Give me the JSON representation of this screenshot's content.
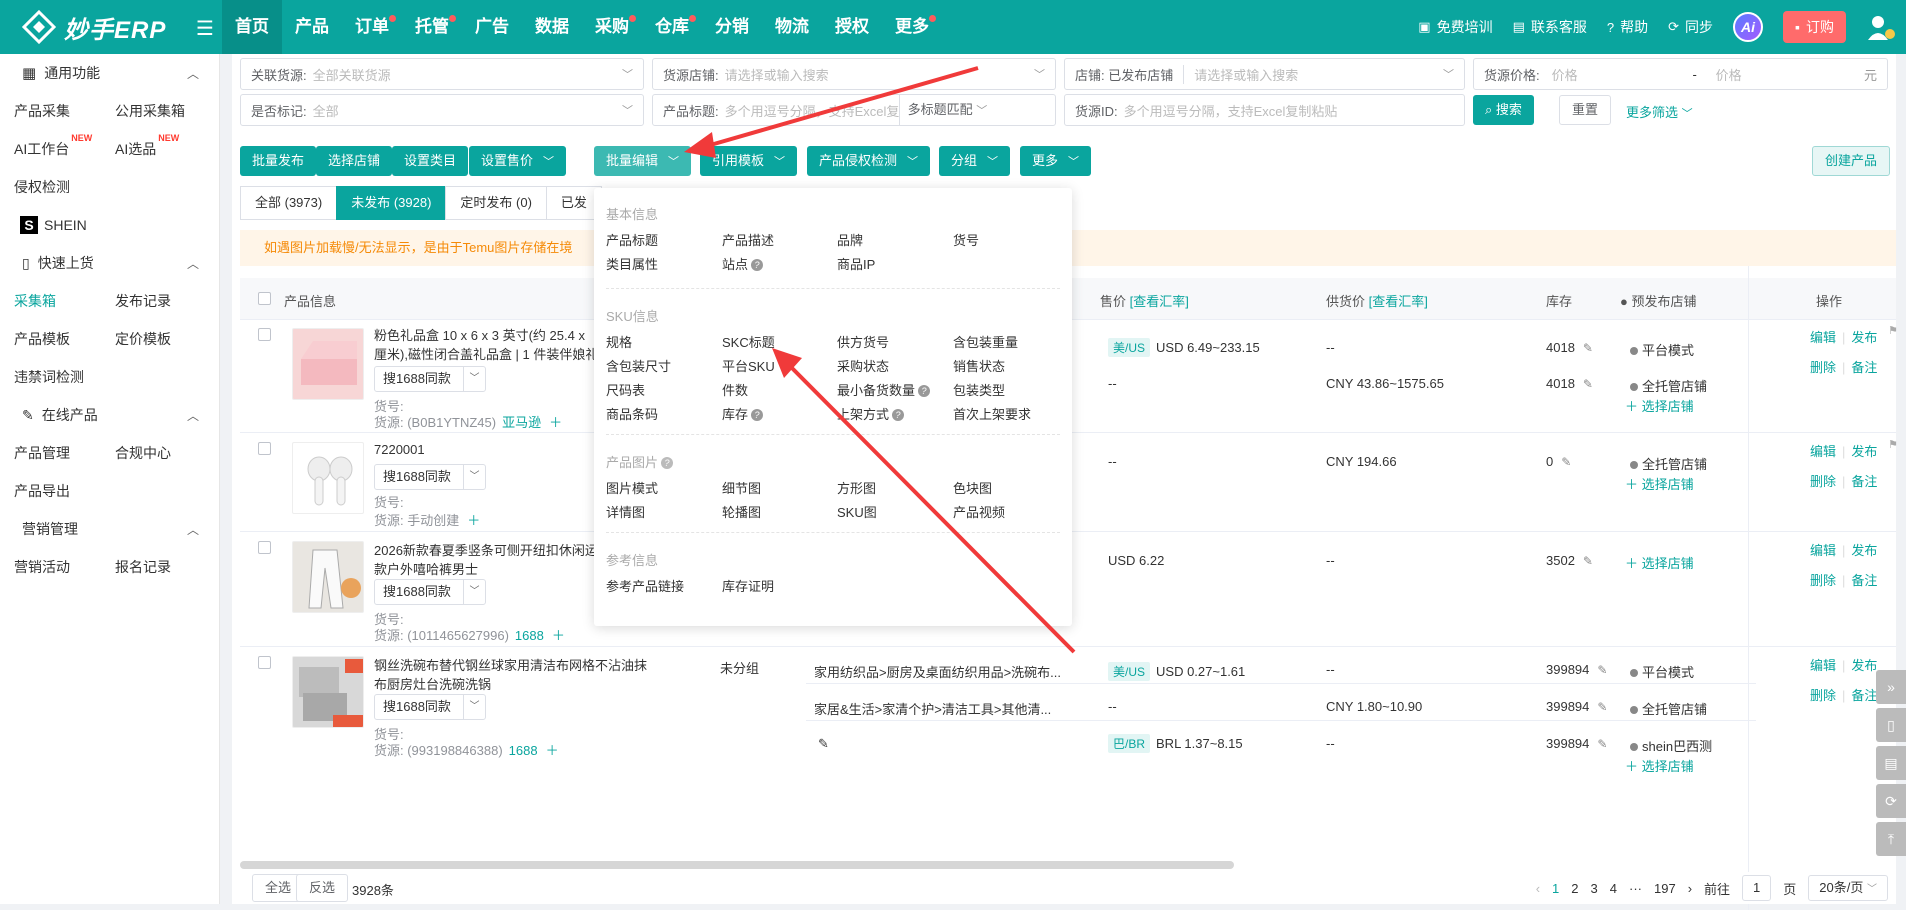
{
  "app": {
    "brand": "妙手ERP"
  },
  "nav": [
    {
      "label": "首页",
      "active": true,
      "dot": false
    },
    {
      "label": "产品",
      "dot": false
    },
    {
      "label": "订单",
      "dot": true
    },
    {
      "label": "托管",
      "dot": true
    },
    {
      "label": "广告",
      "dot": false
    },
    {
      "label": "数据",
      "dot": false
    },
    {
      "label": "采购",
      "dot": true
    },
    {
      "label": "仓库",
      "dot": true
    },
    {
      "label": "分销",
      "dot": false
    },
    {
      "label": "物流",
      "dot": false
    },
    {
      "label": "授权",
      "dot": false
    },
    {
      "label": "更多",
      "dot": true
    }
  ],
  "topright": {
    "training": "免费培训",
    "service": "联系客服",
    "help": "帮助",
    "sync": "同步",
    "ai": "Ai",
    "order": "订购"
  },
  "sidebar": {
    "general": "通用功能",
    "r1": [
      "产品采集",
      "公用采集箱"
    ],
    "r2": [
      "AI工作台",
      "AI选品"
    ],
    "new_tag": "NEW",
    "r3": "侵权检测",
    "shein_logo": "S",
    "shein": "SHEIN",
    "quick": "快速上货",
    "r4": [
      "采集箱",
      "发布记录"
    ],
    "r5": [
      "产品模板",
      "定价模板"
    ],
    "r6": "违禁词检测",
    "online": "在线产品",
    "r7": [
      "产品管理",
      "合规中心"
    ],
    "r8": "产品导出",
    "marketing": "营销管理",
    "r9": [
      "营销活动",
      "报名记录"
    ]
  },
  "filters": {
    "source_label": "关联货源:",
    "source_value": "全部关联货源",
    "store_label": "货源店铺:",
    "store_ph": "请选择或输入搜索",
    "shop_label": "店铺: 已发布店铺",
    "shop_ph": "请选择或输入搜索",
    "price_label": "货源价格:",
    "price_min_ph": "价格",
    "price_sep": "-",
    "price_max_ph": "价格",
    "price_unit": "元",
    "mark_label": "是否标记:",
    "mark_value": "全部",
    "title_label": "产品标题:",
    "title_ph": "多个用逗号分隔，支持Excel复制粘",
    "title_match": "多标题匹配",
    "srcid_label": "货源ID:",
    "srcid_ph": "多个用逗号分隔，支持Excel复制粘贴",
    "search_btn": "搜索",
    "reset_btn": "重置",
    "more_filter": "更多筛选"
  },
  "toolbar": {
    "batch_publish": "批量发布",
    "select_store": "选择店铺",
    "set_category": "设置类目",
    "set_price": "设置售价",
    "batch_edit": "批量编辑",
    "use_template": "引用模板",
    "infringement": "产品侵权检测",
    "group": "分组",
    "more": "更多",
    "create": "创建产品"
  },
  "tabs": [
    "全部 (3973)",
    "未发布 (3928)",
    "定时发布 (0)",
    "已发"
  ],
  "notice": "如遇图片加载慢/无法显示，是由于Temu图片存储在境",
  "table_head": {
    "product": "产品信息",
    "price": "售价",
    "price_link": "[查看汇率]",
    "supply": "供货价",
    "supply_link": "[查看汇率]",
    "stock": "库存",
    "prepub": "预发布店铺",
    "ops": "操作"
  },
  "rows": [
    {
      "title": "粉色礼品盒 10 x 6 x 3 英寸(约 25.4 x\n厘米),磁性闭合盖礼品盒 | 1 件装伴娘礼",
      "sel": "搜1688同款",
      "huohao": "货号:",
      "source": "货源: (B0B1YTNZ45)",
      "source_link": "亚马逊",
      "lines": [
        {
          "tag": "美/US",
          "price": "USD 6.49~233.15",
          "supply": "--",
          "stock": "4018",
          "store": "平台模式"
        },
        {
          "tag": "",
          "price": "--",
          "supply": "CNY 43.86~1575.65",
          "stock": "4018",
          "store": "全托管店铺"
        }
      ],
      "choose": "选择店铺"
    },
    {
      "title": "7220001",
      "sel": "搜1688同款",
      "huohao": "货号:",
      "source": "货源: 手动创建",
      "source_link": "",
      "price": "--",
      "supply": "CNY 194.66",
      "stock": "0",
      "store": "全托管店铺",
      "choose": "选择店铺"
    },
    {
      "title": "2026新款春夏季竖条可侧开纽扣休闲运\n款户外嘻哈裤男士",
      "sel": "搜1688同款",
      "huohao": "货号:",
      "source": "货源: (1011465627996)",
      "source_link": "1688",
      "price": "USD 6.22",
      "supply": "--",
      "stock": "3502",
      "choose": "选择店铺"
    },
    {
      "title": "钢丝洗碗布替代钢丝球家用清洁布网格不沾油抹\n布厨房灶台洗碗洗锅",
      "group": "未分组",
      "sel": "搜1688同款",
      "huohao": "货号:",
      "source": "货源: (993198846388)",
      "source_link": "1688",
      "lines": [
        {
          "cat": "家用纺织品>厨房及桌面纺织用品>洗碗布...",
          "tag": "美/US",
          "price": "USD 0.27~1.61",
          "supply": "--",
          "stock": "399894",
          "store": "平台模式"
        },
        {
          "cat": "家居&生活>家清个护>清洁工具>其他清...",
          "tag": "",
          "price": "--",
          "supply": "CNY 1.80~10.90",
          "stock": "399894",
          "store": "全托管店铺"
        },
        {
          "cat": "",
          "tag": "巴/BR",
          "price": "BRL 1.37~8.15",
          "supply": "--",
          "stock": "399894",
          "store": "shein巴西测"
        }
      ],
      "choose": "选择店铺"
    }
  ],
  "ops": {
    "edit": "编辑",
    "publish": "发布",
    "delete": "删除",
    "note": "备注"
  },
  "dropdown": {
    "basic": "基本信息",
    "basic_items": [
      "产品标题",
      "产品描述",
      "品牌",
      "货号",
      "类目属性",
      "站点",
      "商品IP"
    ],
    "sku": "SKU信息",
    "sku_items": [
      "规格",
      "SKC标题",
      "供方货号",
      "含包装重量",
      "含包装尺寸",
      "平台SKU",
      "采购状态",
      "销售状态",
      "尺码表",
      "件数",
      "最小备货数量",
      "包装类型",
      "商品条码",
      "库存",
      "上架方式",
      "首次上架要求"
    ],
    "images": "产品图片",
    "image_items": [
      "图片模式",
      "细节图",
      "方形图",
      "色块图",
      "详情图",
      "轮播图",
      "SKU图",
      "产品视频"
    ],
    "ref": "参考信息",
    "ref_items": [
      "参考产品链接",
      "库存证明"
    ]
  },
  "footer": {
    "select_all": "全选",
    "invert": "反选",
    "count": "3928条",
    "pages": [
      "1",
      "2",
      "3",
      "4",
      "···",
      "197"
    ],
    "goto": "前往",
    "goto_val": "1",
    "page_unit": "页",
    "per_page": "20条/页"
  }
}
